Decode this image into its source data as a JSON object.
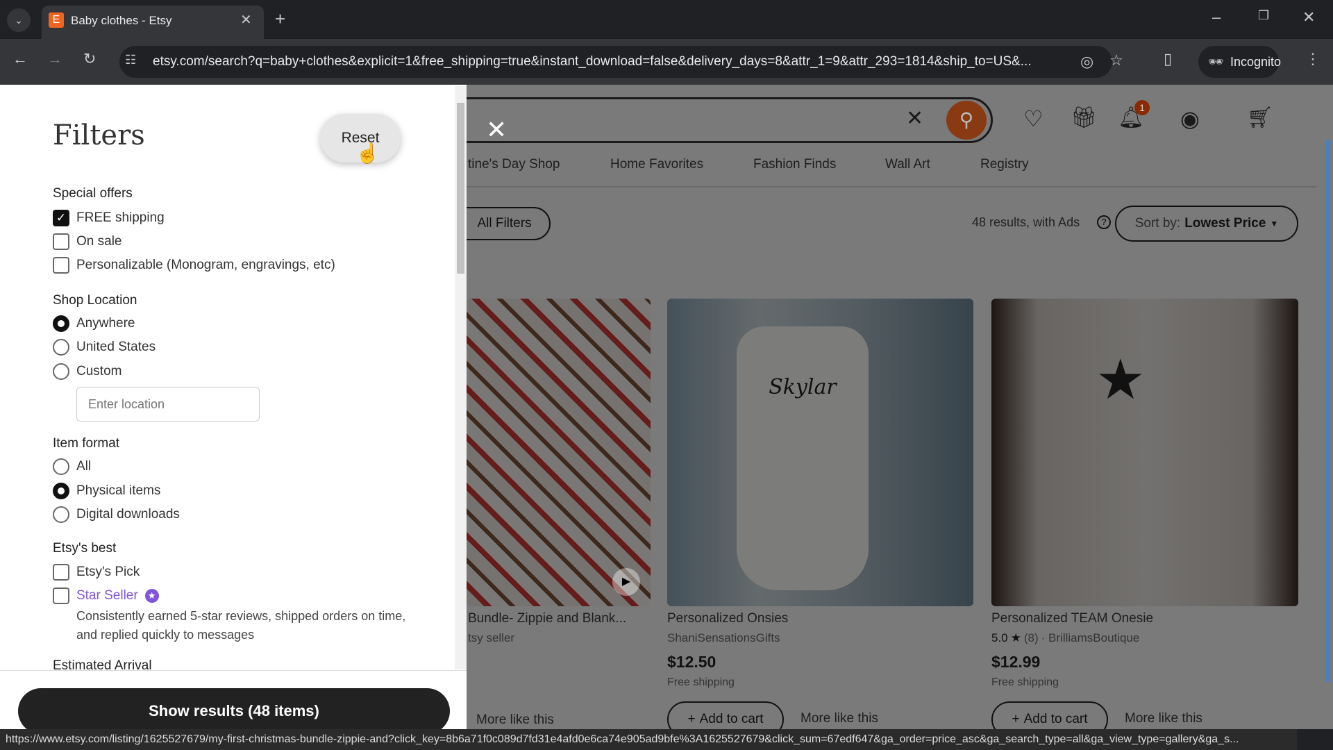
{
  "browser": {
    "tab_title": "Baby clothes - Etsy",
    "url": "etsy.com/search?q=baby+clothes&explicit=1&free_shipping=true&instant_download=false&delivery_days=8&attr_1=9&attr_293=1814&ship_to=US&...",
    "incognito_label": "Incognito",
    "status_url": "https://www.etsy.com/listing/1625527679/my-first-christmas-bundle-zippie-and?click_key=8b6a71f0c089d7fd31e4afd0e6ca74e905ad9bfe%3A1625527679&click_sum=67edf647&ga_order=price_asc&ga_search_type=all&ga_view_type=gallery&ga_s..."
  },
  "header": {
    "notification_count": "1",
    "accent": "#f1641e"
  },
  "nav": [
    "tine's Day Shop",
    "Home Favorites",
    "Fashion Finds",
    "Wall Art",
    "Registry"
  ],
  "results": {
    "all_filters": "All Filters",
    "count_text": "48 results, with Ads",
    "sort_prefix": "Sort by:",
    "sort_value": "Lowest Price"
  },
  "listings": [
    {
      "title": "Bundle- Zippie and Blank...",
      "seller": "tsy seller",
      "more": "More like this"
    },
    {
      "title": "Personalized Onsies",
      "seller": "ShaniSensationsGifts",
      "price": "$12.50",
      "shipping": "Free shipping",
      "add": "Add to cart",
      "more": "More like this"
    },
    {
      "title": "Personalized TEAM Onesie",
      "rating": "5.0",
      "reviews": "(8)",
      "seller": "· BrilliamsBoutique",
      "price": "$12.99",
      "shipping": "Free shipping",
      "add": "Add to cart",
      "more": "More like this"
    }
  ],
  "filters": {
    "title": "Filters",
    "reset": "Reset",
    "special_offers": {
      "label": "Special offers",
      "options": [
        {
          "label": "FREE shipping",
          "checked": true
        },
        {
          "label": "On sale",
          "checked": false
        },
        {
          "label": "Personalizable (Monogram, engravings, etc)",
          "checked": false
        }
      ]
    },
    "shop_location": {
      "label": "Shop Location",
      "options": [
        {
          "label": "Anywhere",
          "selected": true
        },
        {
          "label": "United States",
          "selected": false
        },
        {
          "label": "Custom",
          "selected": false
        }
      ],
      "placeholder": "Enter location"
    },
    "item_format": {
      "label": "Item format",
      "options": [
        {
          "label": "All",
          "selected": false
        },
        {
          "label": "Physical items",
          "selected": true
        },
        {
          "label": "Digital downloads",
          "selected": false
        }
      ]
    },
    "etsys_best": {
      "label": "Etsy's best",
      "options": [
        {
          "label": "Etsy's Pick",
          "checked": false
        },
        {
          "label": "Star Seller",
          "checked": false
        }
      ],
      "star_desc": "Consistently earned 5-star reviews, shipped orders on time, and replied quickly to messages",
      "star_color": "#7f56d9"
    },
    "estimated_arrival": "Estimated Arrival",
    "show_results": "Show results (48 items)"
  }
}
